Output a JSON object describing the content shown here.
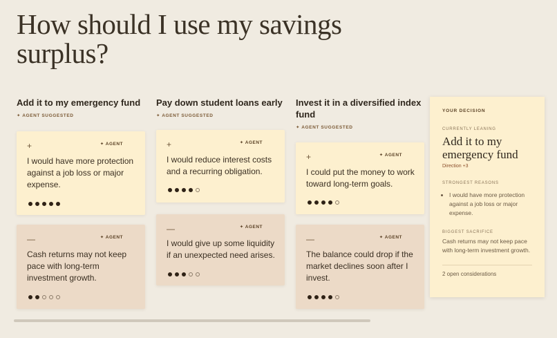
{
  "page": {
    "title": "How should I use my savings surplus?"
  },
  "options": [
    {
      "heading": "Add it to my emergency fund",
      "tag": "✦ AGENT SUGGESTED",
      "pro": {
        "symbol": "+",
        "agent": "✦ AGENT",
        "text": "I would have more protection against a job loss or major expense.",
        "rating": 5,
        "max": 5
      },
      "con": {
        "symbol": "—",
        "agent": "✦ AGENT",
        "text": "Cash returns may not keep pace with long-term investment growth.",
        "rating": 2,
        "max": 5
      }
    },
    {
      "heading": "Pay down student loans early",
      "tag": "✦ AGENT SUGGESTED",
      "pro": {
        "symbol": "+",
        "agent": "✦ AGENT",
        "text": "I would reduce interest costs and a recurring obligation.",
        "rating": 4,
        "max": 5
      },
      "con": {
        "symbol": "—",
        "agent": "✦ AGENT",
        "text": "I would give up some liquidity if an unexpected need arises.",
        "rating": 3,
        "max": 5
      }
    },
    {
      "heading": "Invest it in a diversified index fund",
      "tag": "✦ AGENT SUGGESTED",
      "pro": {
        "symbol": "+",
        "agent": "✦ AGENT",
        "text": "I could put the money to work toward long-term goals.",
        "rating": 4,
        "max": 5
      },
      "con": {
        "symbol": "—",
        "agent": "✦ AGENT",
        "text": "The balance could drop if the market declines soon after I invest.",
        "rating": 4,
        "max": 5
      }
    }
  ],
  "decision": {
    "heading": "YOUR DECISION",
    "leaning_label": "CURRENTLY LEANING",
    "leaning_choice": "Add it to my emergency fund",
    "direction": "Direction +3",
    "reasons_label": "STRONGEST REASONS",
    "reasons": [
      "I would have more protection against a job loss or major expense."
    ],
    "sacrifice_label": "BIGGEST SACRIFICE",
    "sacrifice": "Cash returns may not keep pace with long-term investment growth.",
    "open_considerations": "2 open considerations"
  }
}
